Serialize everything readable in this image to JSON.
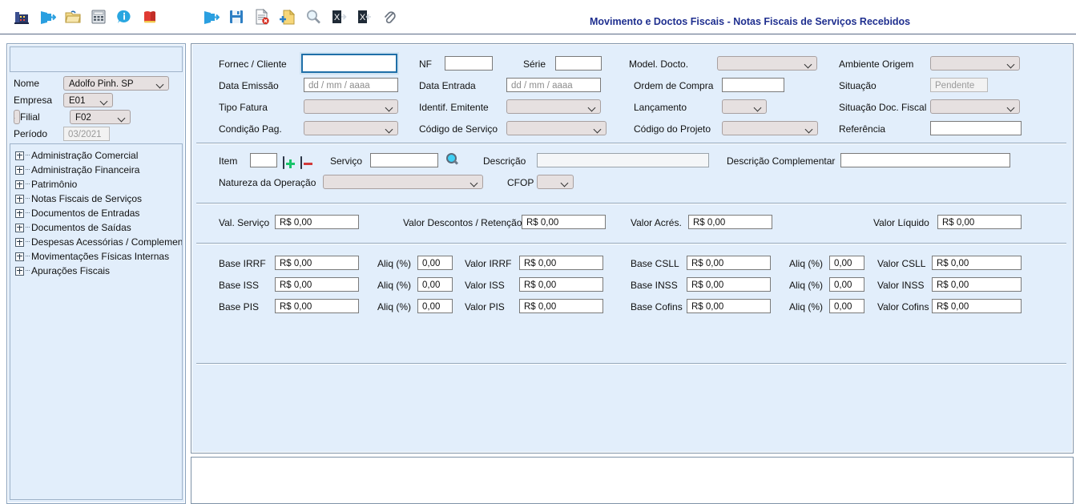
{
  "toolbar": {
    "left_icons": [
      {
        "name": "factory-icon",
        "label": "Estabelecimento"
      },
      {
        "name": "exit-door-icon",
        "label": "Sair"
      },
      {
        "name": "open-folder-icon",
        "label": "Abrir"
      },
      {
        "name": "calculator-icon",
        "label": "Calculadora"
      },
      {
        "name": "info-icon",
        "label": "Informações"
      },
      {
        "name": "book-icon",
        "label": "Manual"
      }
    ],
    "right_icons": [
      {
        "name": "exit-door-icon",
        "label": "Sair"
      },
      {
        "name": "save-floppy-icon",
        "label": "Salvar"
      },
      {
        "name": "delete-document-icon",
        "label": "Excluir"
      },
      {
        "name": "new-document-icon",
        "label": "Novo"
      },
      {
        "name": "search-magnifier-icon",
        "label": "Pesquisar"
      },
      {
        "name": "excel-export-icon",
        "label": "Exportar Excel"
      },
      {
        "name": "excel-import-icon",
        "label": "Importar Excel"
      },
      {
        "name": "attachment-clip-icon",
        "label": "Anexo"
      }
    ]
  },
  "header": {
    "title": "Movimento e Doctos Fiscais - Notas Fiscais de Serviços Recebidos"
  },
  "sidebar": {
    "fields": [
      {
        "label": "Nome",
        "value": "Adolfo Pinh. SP",
        "type": "select"
      },
      {
        "label": "Empresa",
        "value": "E01",
        "type": "select"
      },
      {
        "label": "Filial",
        "value": "F02",
        "type": "select"
      },
      {
        "label": "Período",
        "value": "03/2021",
        "type": "readonly"
      }
    ],
    "tree": [
      {
        "label": "Administração Comercial"
      },
      {
        "label": "Administração Financeira"
      },
      {
        "label": "Patrimônio"
      },
      {
        "label": "Notas Fiscais de Serviços"
      },
      {
        "label": "Documentos de Entradas"
      },
      {
        "label": "Documentos de Saídas"
      },
      {
        "label": "Despesas Acessórias / Complementares"
      },
      {
        "label": "Movimentações Físicas Internas"
      },
      {
        "label": "Apurações Fiscais"
      }
    ]
  },
  "form": {
    "doc_section": {
      "fornec_cliente": {
        "label": "Fornec / Cliente",
        "value": ""
      },
      "nf": {
        "label": "NF",
        "value": ""
      },
      "serie": {
        "label": "Série",
        "value": ""
      },
      "model_docto": {
        "label": "Model. Docto.",
        "value": ""
      },
      "ambiente_origem": {
        "label": "Ambiente Origem",
        "value": ""
      },
      "data_emissao": {
        "label": "Data Emissão",
        "value": "dd / mm / aaaa"
      },
      "data_entrada": {
        "label": "Data Entrada",
        "value": "dd / mm / aaaa"
      },
      "ordem_compra": {
        "label": "Ordem de Compra",
        "value": ""
      },
      "situacao": {
        "label": "Situação",
        "value": "Pendente"
      },
      "tipo_fatura": {
        "label": "Tipo Fatura",
        "value": ""
      },
      "identif_emitente": {
        "label": "Identif. Emitente",
        "value": ""
      },
      "lancamento": {
        "label": "Lançamento",
        "value": ""
      },
      "situacao_doc_fiscal": {
        "label": "Situação Doc. Fiscal",
        "value": ""
      },
      "condicao_pag": {
        "label": "Condição Pag.",
        "value": ""
      },
      "codigo_servico": {
        "label": "Código de Serviço",
        "value": ""
      },
      "codigo_projeto": {
        "label": "Código do Projeto",
        "value": ""
      },
      "referencia": {
        "label": "Referência",
        "value": ""
      }
    },
    "item_section": {
      "item": {
        "label": "Item",
        "value": ""
      },
      "add_button": {
        "label": "+"
      },
      "remove_button": {
        "label": "-"
      },
      "servico": {
        "label": "Serviço",
        "value": ""
      },
      "descricao": {
        "label": "Descrição",
        "value": ""
      },
      "descricao_complementar": {
        "label": "Descrição Complementar",
        "value": ""
      },
      "natureza_operacao": {
        "label": "Natureza da Operação",
        "value": ""
      },
      "cfop": {
        "label": "CFOP",
        "value": ""
      }
    },
    "values_section": {
      "val_servico": {
        "label": "Val. Serviço",
        "value": "R$ 0,00"
      },
      "valor_descontos": {
        "label": "Valor Descontos / Retenção",
        "value": "R$ 0,00"
      },
      "valor_acres": {
        "label": "Valor Acrés.",
        "value": "R$ 0,00"
      },
      "valor_liquido": {
        "label": "Valor Líquido",
        "value": "R$ 0,00"
      }
    },
    "tax_section": {
      "aliq_label": "Aliq (%)",
      "rows_left": [
        {
          "base_label": "Base IRRF",
          "base_value": "R$ 0,00",
          "aliq_value": "0,00",
          "valor_label": "Valor IRRF",
          "valor_value": "R$ 0,00"
        },
        {
          "base_label": "Base ISS",
          "base_value": "R$ 0,00",
          "aliq_value": "0,00",
          "valor_label": "Valor ISS",
          "valor_value": "R$ 0,00"
        },
        {
          "base_label": "Base PIS",
          "base_value": "R$ 0,00",
          "aliq_value": "0,00",
          "valor_label": "Valor PIS",
          "valor_value": "R$ 0,00"
        }
      ],
      "rows_right": [
        {
          "base_label": "Base CSLL",
          "base_value": "R$ 0,00",
          "aliq_value": "0,00",
          "valor_label": "Valor CSLL",
          "valor_value": "R$ 0,00"
        },
        {
          "base_label": "Base INSS",
          "base_value": "R$ 0,00",
          "aliq_value": "0,00",
          "valor_label": "Valor INSS",
          "valor_value": "R$ 0,00"
        },
        {
          "base_label": "Base Cofins",
          "base_value": "R$ 0,00",
          "aliq_value": "0,00",
          "valor_label": "Valor Cofins",
          "valor_value": "R$ 0,00"
        }
      ]
    }
  },
  "colors": {
    "panel_bg": "#e2eefb",
    "title_blue": "#1f2f8f",
    "select_bg": "#e6e0e0",
    "focus_border": "#1f6fa8"
  }
}
